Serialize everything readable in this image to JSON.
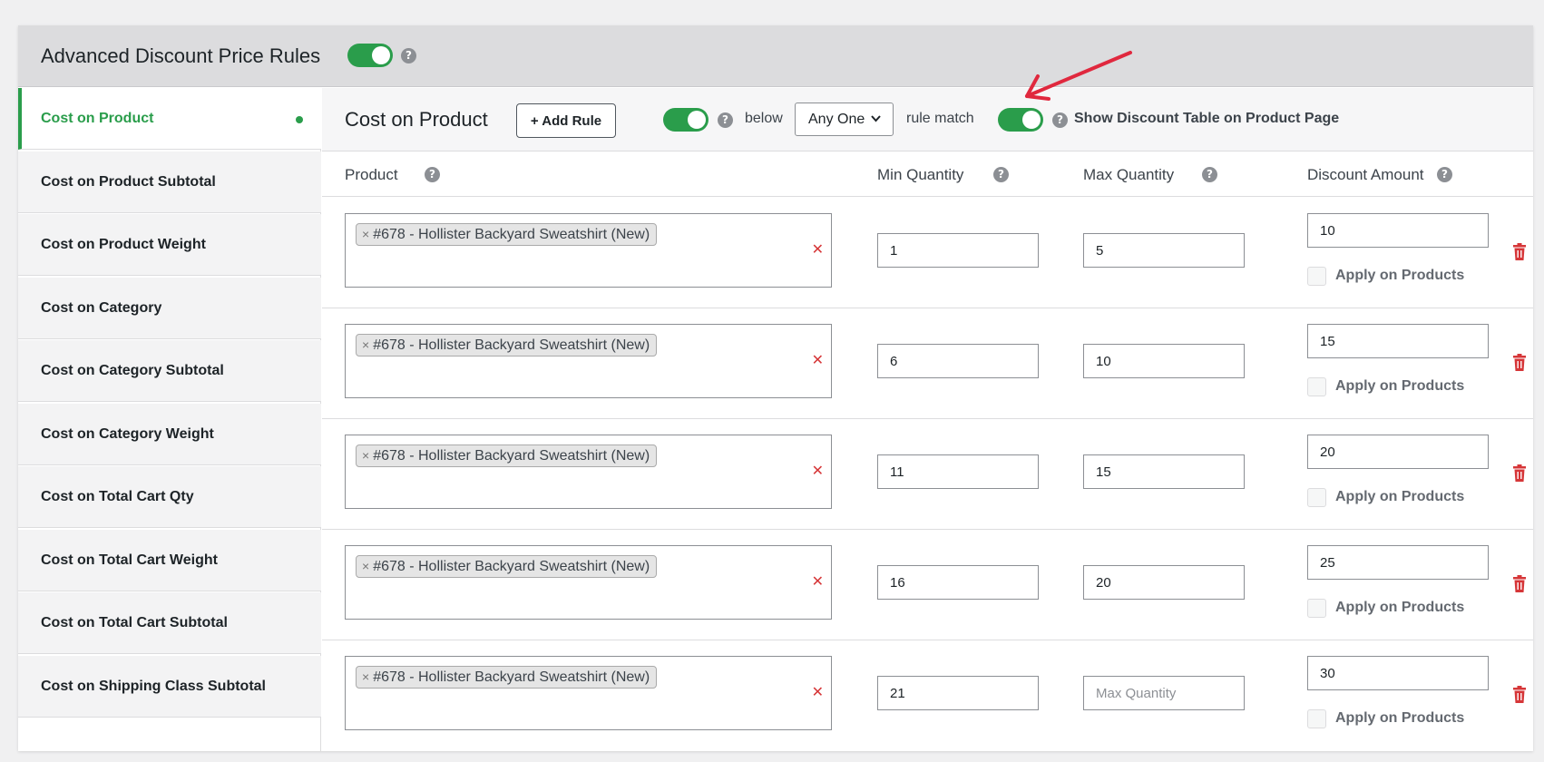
{
  "header": {
    "title": "Advanced Discount Price Rules",
    "help": "?"
  },
  "sidebar": {
    "items": [
      {
        "label": "Cost on Product",
        "active": true
      },
      {
        "label": "Cost on Product Subtotal"
      },
      {
        "label": "Cost on Product Weight"
      },
      {
        "label": "Cost on Category"
      },
      {
        "label": "Cost on Category Subtotal"
      },
      {
        "label": "Cost on Category Weight"
      },
      {
        "label": "Cost on Total Cart Qty"
      },
      {
        "label": "Cost on Total Cart Weight"
      },
      {
        "label": "Cost on Total Cart Subtotal"
      },
      {
        "label": "Cost on Shipping Class Subtotal"
      }
    ]
  },
  "toolbar": {
    "title": "Cost on Product",
    "add_rule_label": "+ Add Rule",
    "below_text": "below",
    "match_select": "Any One",
    "rule_match_text": "rule match",
    "show_table_label": "Show Discount Table on Product Page"
  },
  "columns": {
    "product": "Product",
    "min_qty": "Min Quantity",
    "max_qty": "Max Quantity",
    "discount": "Discount Amount"
  },
  "rows": [
    {
      "product": "#678 - Hollister Backyard Sweatshirt (New)",
      "min": "1",
      "max": "5",
      "discount": "10",
      "apply_label": "Apply on Products"
    },
    {
      "product": "#678 - Hollister Backyard Sweatshirt (New)",
      "min": "6",
      "max": "10",
      "discount": "15",
      "apply_label": "Apply on Products"
    },
    {
      "product": "#678 - Hollister Backyard Sweatshirt (New)",
      "min": "11",
      "max": "15",
      "discount": "20",
      "apply_label": "Apply on Products"
    },
    {
      "product": "#678 - Hollister Backyard Sweatshirt (New)",
      "min": "16",
      "max": "20",
      "discount": "25",
      "apply_label": "Apply on Products"
    },
    {
      "product": "#678 - Hollister Backyard Sweatshirt (New)",
      "min": "21",
      "max": "",
      "max_placeholder": "Max Quantity",
      "discount": "30",
      "apply_label": "Apply on Products"
    }
  ],
  "colors": {
    "accent": "#2a9d4b",
    "danger": "#d63638",
    "arrow": "#e0283e"
  },
  "icons": {
    "remove_tag": "×",
    "clear": "✕",
    "chevron": "chevron-down-icon",
    "delete": "trash-icon"
  }
}
